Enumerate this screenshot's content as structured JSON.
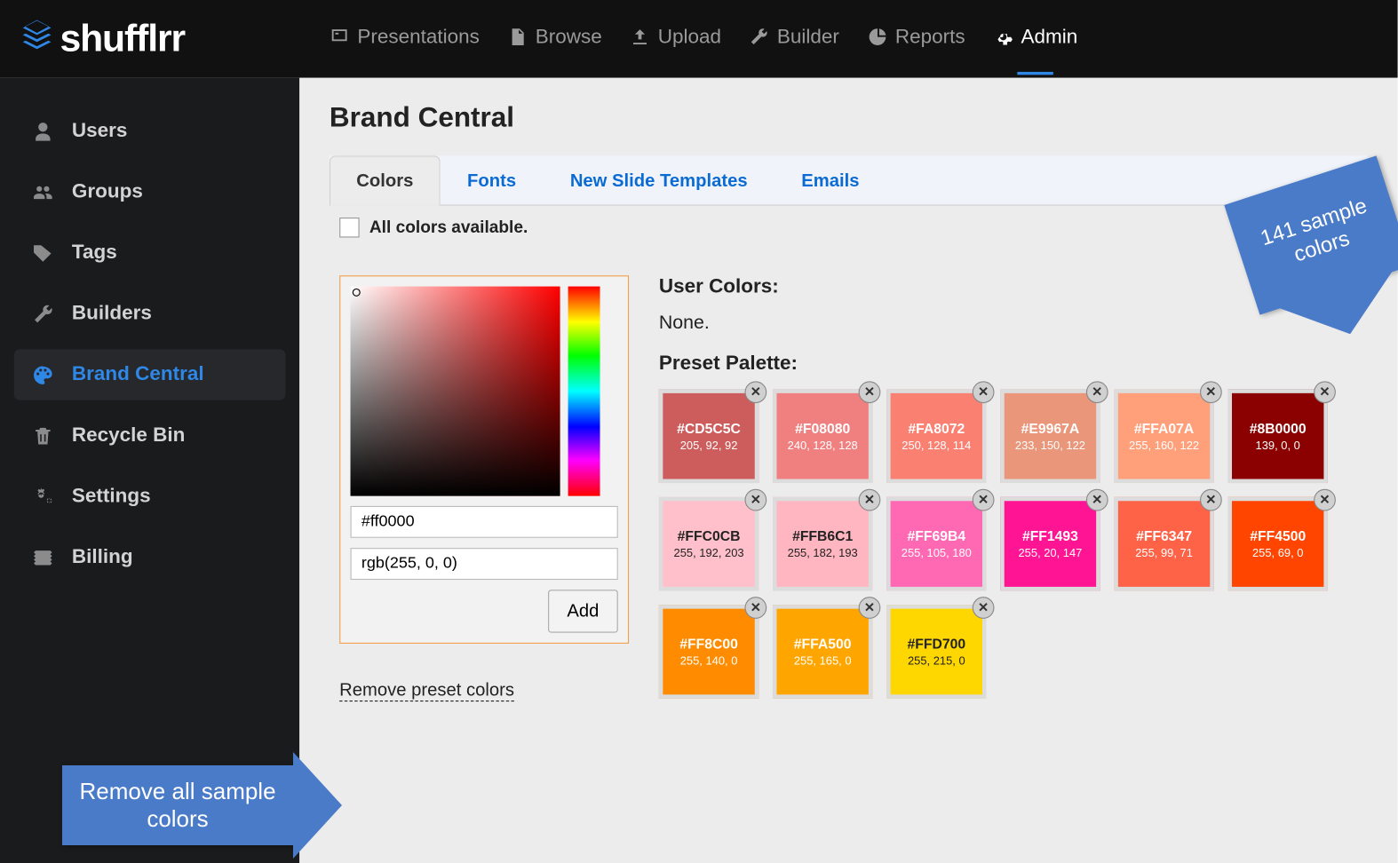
{
  "logo_text": "shufflrr",
  "nav": [
    {
      "label": "Presentations"
    },
    {
      "label": "Browse"
    },
    {
      "label": "Upload"
    },
    {
      "label": "Builder"
    },
    {
      "label": "Reports"
    },
    {
      "label": "Admin"
    }
  ],
  "sidebar": [
    {
      "label": "Users"
    },
    {
      "label": "Groups"
    },
    {
      "label": "Tags"
    },
    {
      "label": "Builders"
    },
    {
      "label": "Brand Central"
    },
    {
      "label": "Recycle Bin"
    },
    {
      "label": "Settings"
    },
    {
      "label": "Billing"
    }
  ],
  "page_title": "Brand Central",
  "tabs": [
    {
      "label": "Colors"
    },
    {
      "label": "Fonts"
    },
    {
      "label": "New Slide Templates"
    },
    {
      "label": "Emails"
    }
  ],
  "checkbox_label": "All colors available.",
  "hex_value": "#ff0000",
  "rgb_value": "rgb(255, 0, 0)",
  "add_label": "Add",
  "user_colors_label": "User Colors:",
  "user_colors_none": "None.",
  "preset_label": "Preset Palette:",
  "remove_link": "Remove preset colors",
  "callout_right": "141 sample colors",
  "callout_left": "Remove all sample colors",
  "swatches": [
    {
      "hex": "#CD5C5C",
      "rgb": "205, 92, 92",
      "bg": "#CD5C5C",
      "dark": false
    },
    {
      "hex": "#F08080",
      "rgb": "240, 128, 128",
      "bg": "#F08080",
      "dark": false
    },
    {
      "hex": "#FA8072",
      "rgb": "250, 128, 114",
      "bg": "#FA8072",
      "dark": false
    },
    {
      "hex": "#E9967A",
      "rgb": "233, 150, 122",
      "bg": "#E9967A",
      "dark": false
    },
    {
      "hex": "#FFA07A",
      "rgb": "255, 160, 122",
      "bg": "#FFA07A",
      "dark": false
    },
    {
      "hex": "#8B0000",
      "rgb": "139, 0, 0",
      "bg": "#8B0000",
      "dark": false
    },
    {
      "hex": "#FFC0CB",
      "rgb": "255, 192, 203",
      "bg": "#FFC0CB",
      "dark": true
    },
    {
      "hex": "#FFB6C1",
      "rgb": "255, 182, 193",
      "bg": "#FFB6C1",
      "dark": true
    },
    {
      "hex": "#FF69B4",
      "rgb": "255, 105, 180",
      "bg": "#FF69B4",
      "dark": false
    },
    {
      "hex": "#FF1493",
      "rgb": "255, 20, 147",
      "bg": "#FF1493",
      "dark": false
    },
    {
      "hex": "#FF6347",
      "rgb": "255, 99, 71",
      "bg": "#FF6347",
      "dark": false
    },
    {
      "hex": "#FF4500",
      "rgb": "255, 69, 0",
      "bg": "#FF4500",
      "dark": false
    },
    {
      "hex": "#FF8C00",
      "rgb": "255, 140, 0",
      "bg": "#FF8C00",
      "dark": false
    },
    {
      "hex": "#FFA500",
      "rgb": "255, 165, 0",
      "bg": "#FFA500",
      "dark": false
    },
    {
      "hex": "#FFD700",
      "rgb": "255, 215, 0",
      "bg": "#FFD700",
      "dark": true
    }
  ]
}
